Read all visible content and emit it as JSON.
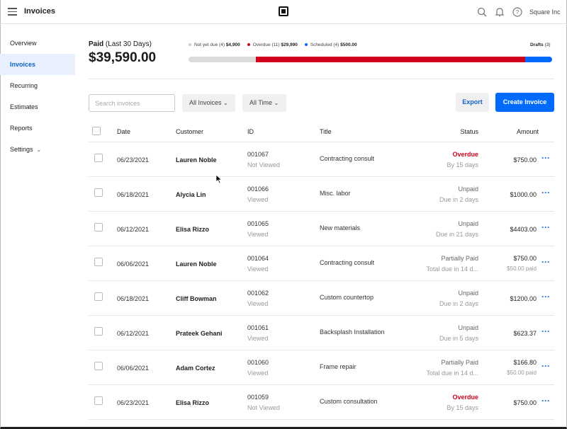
{
  "header": {
    "title": "Invoices",
    "company": "Square Inc"
  },
  "sidebar": {
    "items": [
      {
        "label": "Overview"
      },
      {
        "label": "Invoices"
      },
      {
        "label": "Recurring"
      },
      {
        "label": "Estimates"
      },
      {
        "label": "Reports"
      },
      {
        "label": "Settings"
      }
    ]
  },
  "summary": {
    "paid_label": "Paid",
    "paid_period": "(Last 30 Days)",
    "paid_amount": "$39,590.00",
    "legend": [
      {
        "label": "Not yet due (4)",
        "value": "$4,900",
        "color": "#cccccc"
      },
      {
        "label": "Overdue (11)",
        "value": "$29,990",
        "color": "#d0021b"
      },
      {
        "label": "Scheduled (4)",
        "value": "$500.00",
        "color": "#006aff"
      }
    ],
    "progress": [
      {
        "name": "not-yet-due",
        "fraction": 0.185,
        "color": "#dcdcdc"
      },
      {
        "name": "overdue",
        "fraction": 0.74,
        "color": "#d0021b"
      },
      {
        "name": "scheduled",
        "fraction": 0.075,
        "color": "#006aff"
      }
    ],
    "drafts_label": "Drafts",
    "drafts_count": "(3)"
  },
  "toolbar": {
    "search_placeholder": "Search invoices",
    "filter_invoices": "All Invoices",
    "filter_time": "All Time",
    "export_label": "Export",
    "create_label": "Create Invoice"
  },
  "table": {
    "headers": {
      "date": "Date",
      "customer": "Customer",
      "id": "ID",
      "title": "Title",
      "status": "Status",
      "amount": "Amount"
    },
    "rows": [
      {
        "date": "06/23/2021",
        "customer": "Lauren Noble",
        "id": "001067",
        "view": "Not Viewed",
        "title": "Contracting consult",
        "status": "Overdue",
        "status_sub": "By 15 days",
        "amount": "$750.00",
        "amount_sub": "",
        "overdue": true
      },
      {
        "date": "06/18/2021",
        "customer": "Alycia Lin",
        "id": "001066",
        "view": "Viewed",
        "title": "Misc. labor",
        "status": "Unpaid",
        "status_sub": "Due in 2 days",
        "amount": "$1000.00",
        "amount_sub": "",
        "overdue": false
      },
      {
        "date": "06/12/2021",
        "customer": "Elisa Rizzo",
        "id": "001065",
        "view": "Viewed",
        "title": "New materials",
        "status": "Unpaid",
        "status_sub": "Due in 21 days",
        "amount": "$4403.00",
        "amount_sub": "",
        "overdue": false
      },
      {
        "date": "06/06/2021",
        "customer": "Lauren Noble",
        "id": "001064",
        "view": "Viewed",
        "title": "Contracting consult",
        "status": "Partially Paid",
        "status_sub": "Total due in 14 d...",
        "amount": "$750.00",
        "amount_sub": "$50.00 paid",
        "overdue": false
      },
      {
        "date": "06/18/2021",
        "customer": "Cliff Bowman",
        "id": "001062",
        "view": "Viewed",
        "title": "Custom countertop",
        "status": "Unpaid",
        "status_sub": "Due in 2 days",
        "amount": "$1200.00",
        "amount_sub": "",
        "overdue": false
      },
      {
        "date": "06/12/2021",
        "customer": "Prateek Gehani",
        "id": "001061",
        "view": "Viewed",
        "title": "Backsplash Installation",
        "status": "Unpaid",
        "status_sub": "Due in 5 days",
        "amount": "$623.37",
        "amount_sub": "",
        "overdue": false
      },
      {
        "date": "06/06/2021",
        "customer": "Adam Cortez",
        "id": "001060",
        "view": "Viewed",
        "title": "Frame repair",
        "status": "Partially Paid",
        "status_sub": "Total due in 14 d...",
        "amount": "$166.80",
        "amount_sub": "$50.00 paid",
        "overdue": false
      },
      {
        "date": "06/23/2021",
        "customer": "Elisa Rizzo",
        "id": "001059",
        "view": "Not Viewed",
        "title": "Custom consultation",
        "status": "Overdue",
        "status_sub": "By 15 days",
        "amount": "$750.00",
        "amount_sub": "",
        "overdue": true
      }
    ]
  },
  "colors": {
    "accent": "#006aff",
    "overdue": "#d0021b",
    "active_nav_bg": "#e7f0fc"
  }
}
